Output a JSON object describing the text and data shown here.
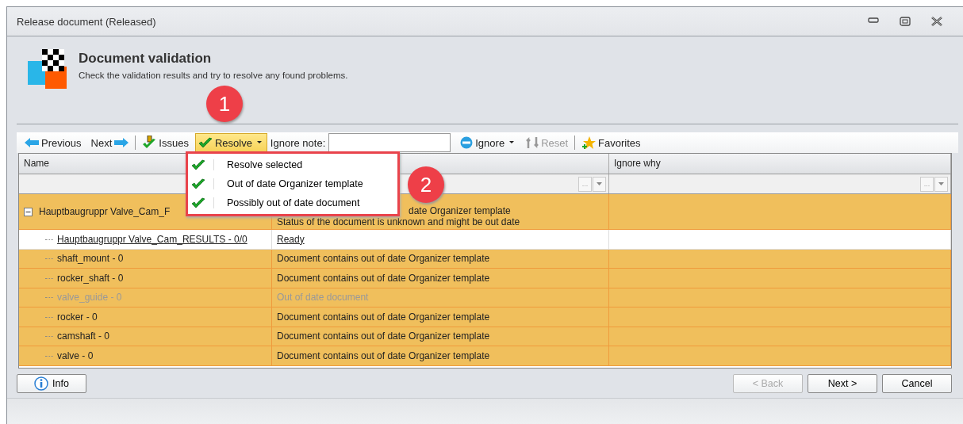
{
  "window": {
    "title": "Release document (Released)"
  },
  "header": {
    "title": "Document validation",
    "subtitle": "Check the validation results and try to resolve any found problems."
  },
  "toolbar": [
    {
      "kind": "nav",
      "label": "Previous"
    },
    {
      "kind": "nav",
      "label": "Next"
    },
    {
      "kind": "sep"
    },
    {
      "kind": "button",
      "label": "Issues",
      "disabled": false
    },
    {
      "kind": "menu",
      "label": "Resolve",
      "expanded": true
    },
    {
      "kind": "field",
      "label": "Ignore note:"
    },
    {
      "kind": "menu",
      "label": "Ignore",
      "expanded": false
    },
    {
      "kind": "button",
      "label": "Reset",
      "disabled": true
    },
    {
      "kind": "sep"
    },
    {
      "kind": "button",
      "label": "Favorites",
      "disabled": false
    }
  ],
  "resolve_menu": [
    "Resolve selected",
    "Out of date Organizer template",
    "Possibly out of date document"
  ],
  "table": {
    "columns": [
      "Name",
      "Ignore why"
    ],
    "filter_buttons": [
      "...",
      "..."
    ],
    "group": {
      "name": "Hauptbaugruppr Valve_Cam_F",
      "expanded": true,
      "issue": true,
      "messages": [
        "date Organizer template",
        "Status of the document is unknown and might be out date"
      ],
      "children": [
        {
          "name": "Hauptbaugruppr Valve_Cam_RESULTS - 0/0",
          "message": "Ready",
          "issue": false,
          "selected": true,
          "disabled": false
        },
        {
          "name": "shaft_mount - 0",
          "message": "Document contains out of date Organizer template",
          "issue": true,
          "selected": false,
          "disabled": false
        },
        {
          "name": "rocker_shaft - 0",
          "message": "Document contains out of date Organizer template",
          "issue": true,
          "selected": false,
          "disabled": false
        },
        {
          "name": "valve_guide - 0",
          "message": "Out of date document",
          "issue": true,
          "selected": false,
          "disabled": true
        },
        {
          "name": "rocker - 0",
          "message": "Document contains out of date Organizer template",
          "issue": true,
          "selected": false,
          "disabled": false
        },
        {
          "name": "camshaft - 0",
          "message": "Document contains out of date Organizer template",
          "issue": true,
          "selected": false,
          "disabled": false
        },
        {
          "name": "valve - 0",
          "message": "Document contains out of date Organizer template",
          "issue": true,
          "selected": false,
          "disabled": false
        }
      ]
    }
  },
  "footer": {
    "info": "Info",
    "buttons": [
      {
        "label": "< Back",
        "disabled": true
      },
      {
        "label": "Next >",
        "disabled": false
      },
      {
        "label": "Cancel",
        "disabled": false
      }
    ]
  },
  "annotations": [
    "1",
    "2"
  ]
}
